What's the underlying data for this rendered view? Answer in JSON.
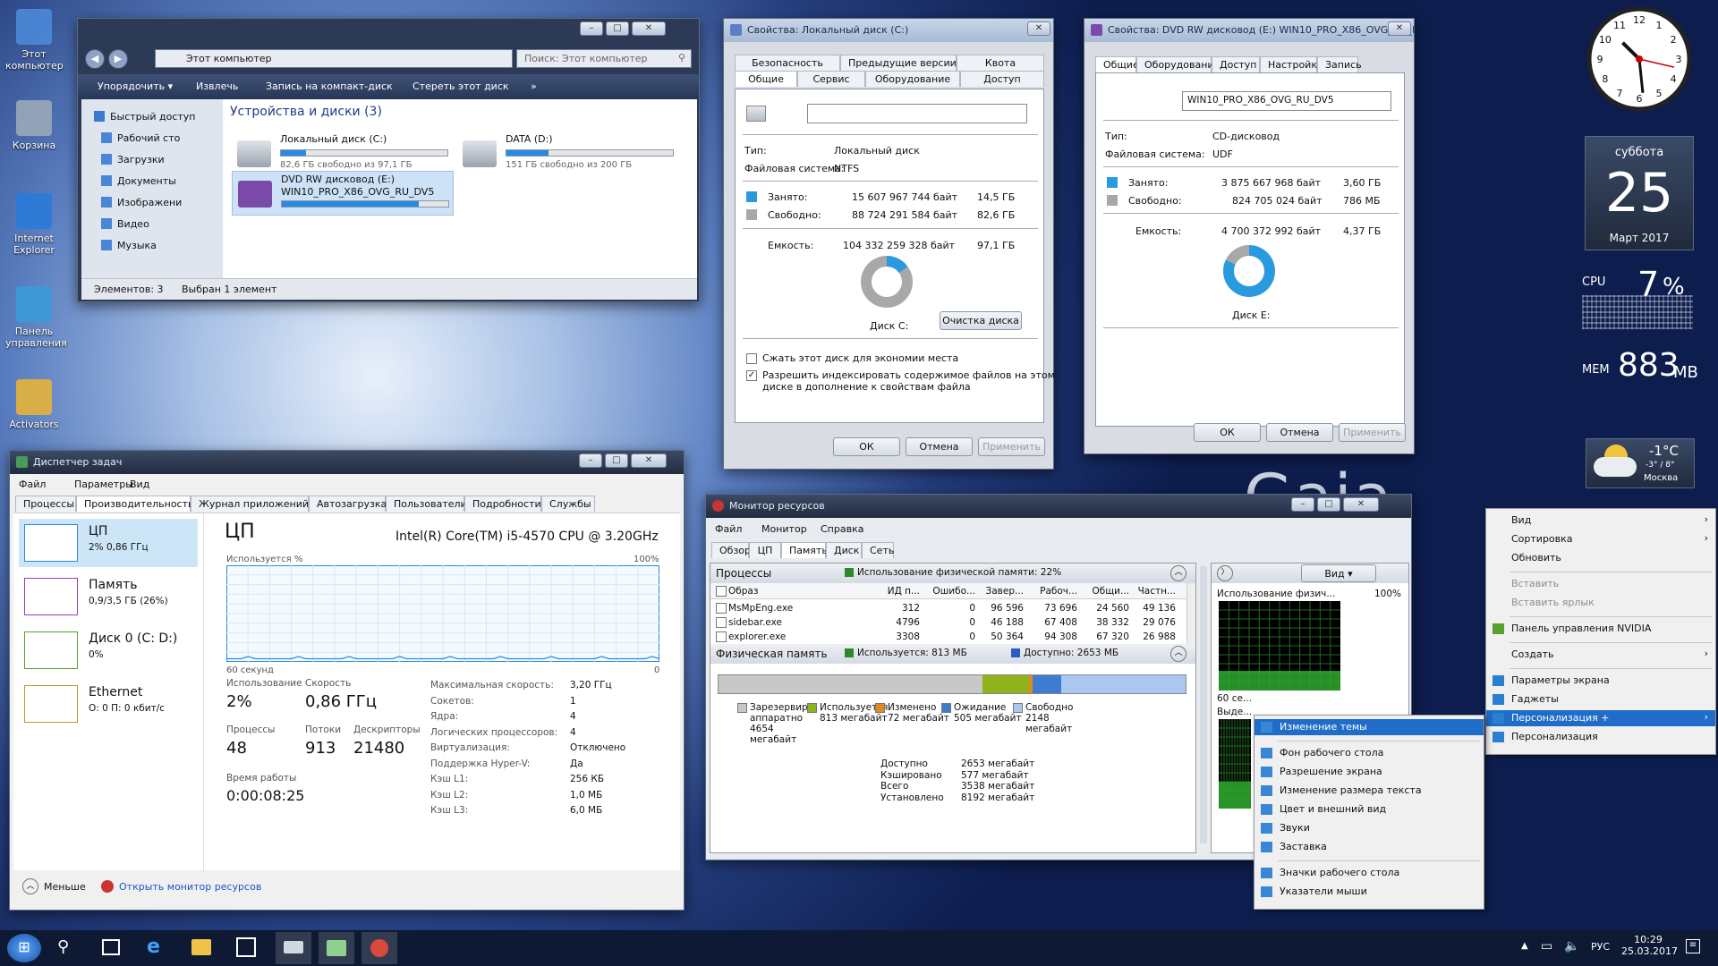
{
  "desktop": {
    "icons": [
      "Этот компьютер",
      "Корзина",
      "Internet Explorer",
      "Панель управления",
      "Activators"
    ],
    "logo": "Gaia"
  },
  "explorer": {
    "address": "Этот компьютер",
    "search_placeholder": "Поиск: Этот компьютер",
    "toolbar": [
      "Упорядочить ▾",
      "Извлечь",
      "Запись на компакт-диск",
      "Стереть этот диск",
      "»"
    ],
    "nav": [
      "Быстрый доступ",
      "Рабочий сто",
      "Загрузки",
      "Документы",
      "Изображени",
      "Видео",
      "Музыка"
    ],
    "group": "Устройства и диски (3)",
    "drives": [
      {
        "name": "Локальный диск (C:)",
        "info": "82,6 ГБ свободно из 97,1 ГБ",
        "fill": 0.15
      },
      {
        "name": "DATA (D:)",
        "info": "151 ГБ свободно из 200 ГБ",
        "fill": 0.25
      },
      {
        "name": "DVD RW дисковод (E:)",
        "name2": "WIN10_PRO_X86_OVG_RU_DV5",
        "fill": 0.82
      }
    ],
    "status_left": "Элементов: 3",
    "status_mid": "Выбран 1 элемент"
  },
  "propc": {
    "title": "Свойства: Локальный диск (C:)",
    "tabs_top": [
      "Безопасность",
      "Предыдущие версии",
      "Квота"
    ],
    "tabs_bottom": [
      "Общие",
      "Сервис",
      "Оборудование",
      "Доступ"
    ],
    "type_label": "Тип:",
    "type": "Локальный диск",
    "fs_label": "Файловая система:",
    "fs": "NTFS",
    "used_label": "Занято:",
    "used_bytes": "15 607 967 744 байт",
    "used_gb": "14,5 ГБ",
    "free_label": "Свободно:",
    "free_bytes": "88 724 291 584 байт",
    "free_gb": "82,6 ГБ",
    "cap_label": "Емкость:",
    "cap_bytes": "104 332 259 328 байт",
    "cap_gb": "97,1 ГБ",
    "disk_label": "Диск C:",
    "cleanup": "Очистка диска",
    "compress": "Сжать этот диск для экономии места",
    "index": "Разрешить индексировать содержимое файлов на этом",
    "index2": "диске в дополнение к свойствам файла",
    "ok": "ОК",
    "cancel": "Отмена",
    "apply": "Применить",
    "used_fraction": 0.15
  },
  "prope": {
    "title": "Свойства: DVD RW дисковод (E:) WIN10_PRO_X86_OVG_RU_DV...",
    "tabs": [
      "Общие",
      "Оборудование",
      "Доступ",
      "Настройка",
      "Запись"
    ],
    "label": "WIN10_PRO_X86_OVG_RU_DV5",
    "type_label": "Тип:",
    "type": "CD-дисковод",
    "fs_label": "Файловая система:",
    "fs": "UDF",
    "used_label": "Занято:",
    "used_bytes": "3 875 667 968 байт",
    "used_gb": "3,60 ГБ",
    "free_label": "Свободно:",
    "free_bytes": "824 705 024 байт",
    "free_gb": "786 МБ",
    "cap_label": "Емкость:",
    "cap_bytes": "4 700 372 992 байт",
    "cap_gb": "4,37 ГБ",
    "disk_label": "Диск E:",
    "ok": "ОК",
    "cancel": "Отмена",
    "apply": "Применить",
    "used_fraction": 0.82
  },
  "taskmgr": {
    "title": "Диспетчер задач",
    "menu": [
      "Файл",
      "Параметры",
      "Вид"
    ],
    "tabs": [
      "Процессы",
      "Производительность",
      "Журнал приложений",
      "Автозагрузка",
      "Пользователи",
      "Подробности",
      "Службы"
    ],
    "side": [
      {
        "name": "ЦП",
        "sub": "2% 0,86 ГГц"
      },
      {
        "name": "Память",
        "sub": "0,9/3,5 ГБ (26%)"
      },
      {
        "name": "Диск 0 (C: D:)",
        "sub": "0%"
      },
      {
        "name": "Ethernet",
        "sub": "О: 0 П: 0 кбит/с"
      }
    ],
    "heading": "ЦП",
    "cpu": "Intel(R) Core(TM) i5-4570 CPU @ 3.20GHz",
    "usage_label": "Используется %",
    "max_pct": "100%",
    "seconds": "60 секунд",
    "zero": "0",
    "stats": [
      {
        "l": "Использование",
        "v": "2%"
      },
      {
        "l": "Скорость",
        "v": "0,86 ГГц"
      },
      {
        "l": "Процессы",
        "v": "48"
      },
      {
        "l": "Потоки",
        "v": "913"
      },
      {
        "l": "Дескрипторы",
        "v": "21480"
      },
      {
        "l": "Время работы",
        "v": "0:00:08:25"
      }
    ],
    "props": [
      [
        "Максимальная скорость:",
        "3,20 ГГц"
      ],
      [
        "Сокетов:",
        "1"
      ],
      [
        "Ядра:",
        "4"
      ],
      [
        "Логических процессоров:",
        "4"
      ],
      [
        "Виртуализация:",
        "Отключено"
      ],
      [
        "Поддержка Hyper-V:",
        "Да"
      ],
      [
        "Кэш L1:",
        "256 КБ"
      ],
      [
        "Кэш L2:",
        "1,0 МБ"
      ],
      [
        "Кэш L3:",
        "6,0 МБ"
      ]
    ],
    "less": "Меньше",
    "open_rm": "Открыть монитор ресурсов"
  },
  "resmon": {
    "title": "Монитор ресурсов",
    "menu": [
      "Файл",
      "Монитор",
      "Справка"
    ],
    "tabs": [
      "Обзор",
      "ЦП",
      "Память",
      "Диск",
      "Сеть"
    ],
    "proc_header": "Процессы",
    "proc_usage": "Использование физической памяти: 22%",
    "cols": [
      "Образ",
      "ИД п...",
      "Ошибо...",
      "Завер...",
      "Рабоч...",
      "Общи...",
      "Частн..."
    ],
    "rows": [
      [
        "MsMpEng.exe",
        "312",
        "0",
        "96 596",
        "73 696",
        "24 560",
        "49 136"
      ],
      [
        "sidebar.exe",
        "4796",
        "0",
        "46 188",
        "67 408",
        "38 332",
        "29 076"
      ],
      [
        "explorer.exe",
        "3308",
        "0",
        "50 364",
        "94 308",
        "67 320",
        "26 988"
      ]
    ],
    "phys_header": "Физическая память",
    "phys_used": "Используется: 813 МБ",
    "phys_avail": "Доступно: 2653 МБ",
    "legend": [
      {
        "l": "Зарезервиро",
        "l2": "аппаратно",
        "l3": "4654",
        "l4": "мегабайт",
        "c": "#c8c8c8"
      },
      {
        "l": "Используется",
        "l2": "813 мегабайт",
        "c": "#8fb31a"
      },
      {
        "l": "Изменено",
        "l2": "72 мегабайт",
        "c": "#e08a1b"
      },
      {
        "l": "Ожидание",
        "l2": "505 мегабайт",
        "c": "#3f7bd0"
      },
      {
        "l": "Свободно",
        "l2": "2148",
        "l3": "мегабайт",
        "c": "#a9c7f0"
      }
    ],
    "summary": [
      [
        "Доступно",
        "2653 мегабайт"
      ],
      [
        "Кэшировано",
        "577 мегабайт"
      ],
      [
        "Всего",
        "3538 мегабайт"
      ],
      [
        "Установлено",
        "8192 мегабайт"
      ]
    ],
    "view": "Вид",
    "graph_label": "Использование физич...",
    "graph_max": "100%",
    "graph_secs": "60 се...",
    "graph_label2": "Выде..."
  },
  "gadgets": {
    "day": "суббота",
    "date": "25",
    "month": "Март 2017",
    "cpu_label": "CPU",
    "cpu_val": "7",
    "cpu_pct": "%",
    "mem_label": "MEM",
    "mem_val": "883",
    "mem_unit": "MB",
    "temp": "-1°C",
    "temp_range": "-3° / 8°",
    "city": "Москва"
  },
  "ctxmenu": {
    "items": [
      {
        "l": "Вид",
        "arrow": true
      },
      {
        "l": "Сортировка",
        "arrow": true
      },
      {
        "l": "Обновить"
      },
      {
        "sep": true
      },
      {
        "l": "Вставить",
        "dis": true
      },
      {
        "l": "Вставить ярлык",
        "dis": true
      },
      {
        "sep": true
      },
      {
        "l": "Панель управления NVIDIA",
        "icon": "#5aa02c"
      },
      {
        "sep": true
      },
      {
        "l": "Создать",
        "arrow": true
      },
      {
        "sep": true
      },
      {
        "l": "Параметры экрана",
        "icon": "#2a7fd0"
      },
      {
        "l": "Гаджеты",
        "icon": "#2a7fd0"
      },
      {
        "l": "Персонализация +",
        "arrow": true,
        "sel": true,
        "icon": "#2a7fd0"
      },
      {
        "l": "Персонализация",
        "icon": "#2a7fd0"
      }
    ]
  },
  "submenu": {
    "items": [
      {
        "l": "Изменение темы",
        "sel": true
      },
      {
        "sep": true
      },
      {
        "l": "Фон рабочего стола"
      },
      {
        "l": "Разрешение экрана"
      },
      {
        "l": "Изменение размера текста"
      },
      {
        "l": "Цвет и внешний вид"
      },
      {
        "l": "Звуки"
      },
      {
        "l": "Заставка"
      },
      {
        "sep": true
      },
      {
        "l": "Значки рабочего стола"
      },
      {
        "l": "Указатели мыши"
      }
    ]
  },
  "taskbar": {
    "lang": "РУС",
    "time": "10:29",
    "date": "25.03.2017",
    "colors": {
      "bg": "#0e1a33",
      "accent": "#1f6dc9"
    }
  }
}
